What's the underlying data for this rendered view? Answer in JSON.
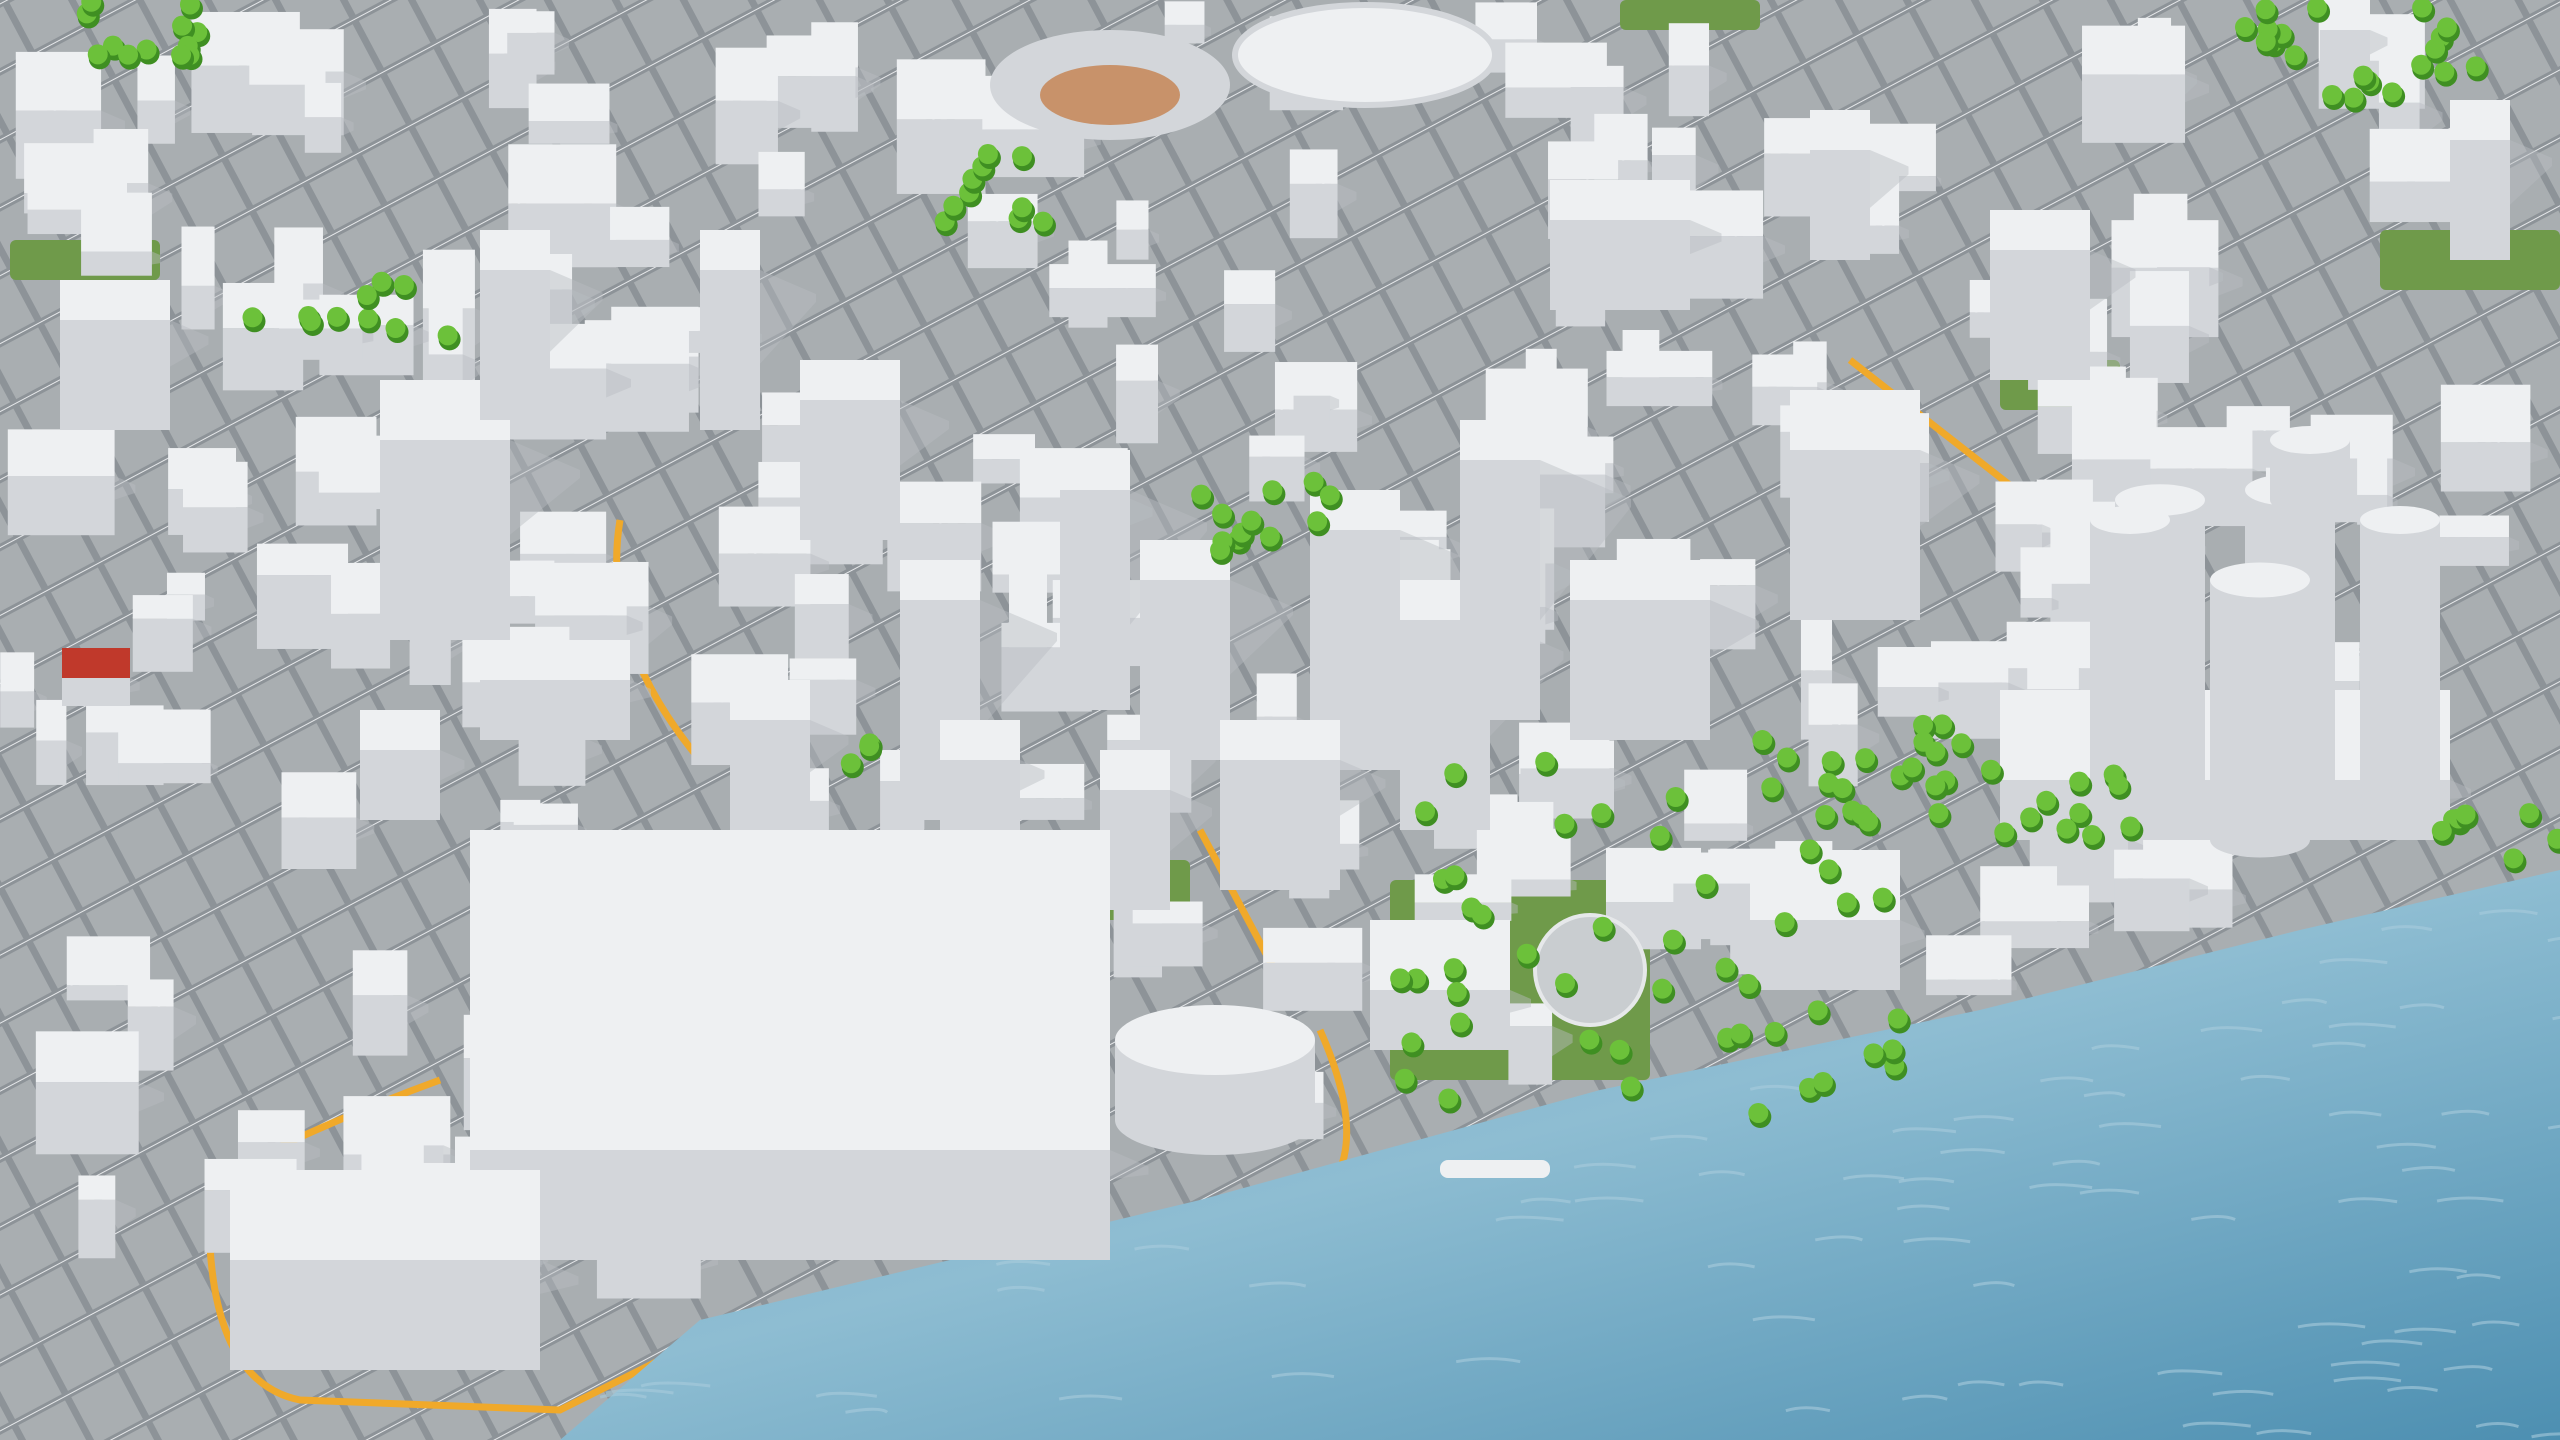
{
  "scene": {
    "colors": {
      "ground": "#a9aeb1",
      "road": "#8d9398",
      "road_marking": "#e6e8ea",
      "highlight_road": "#f0a92a",
      "building_top": "#eef0f2",
      "building_side": "#d3d6da",
      "building_shadow": "#b8bcc1",
      "tree": "#6cc13a",
      "tree_dark": "#3f8f22",
      "grass": "#6f9a4a",
      "water": "#5a98b8",
      "water_light": "#a9cbdc",
      "accent_building": "#c0392b"
    }
  }
}
